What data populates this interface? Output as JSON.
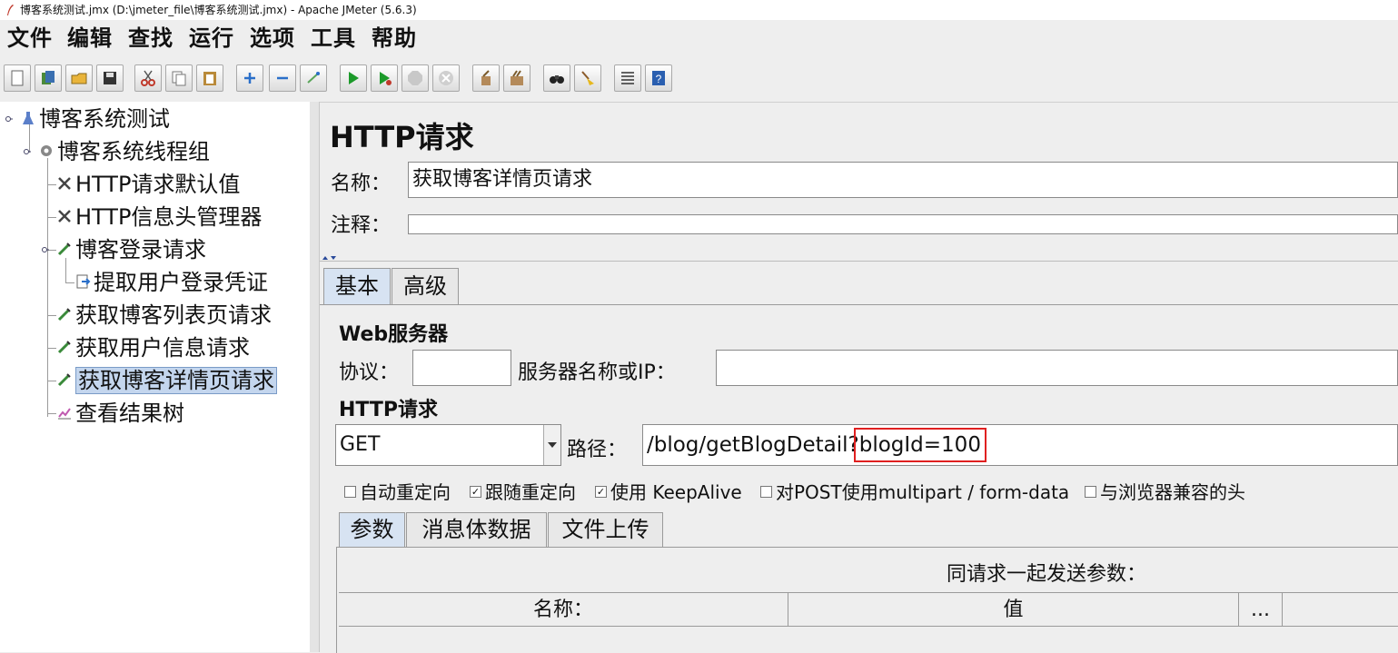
{
  "window": {
    "title": "博客系统测试.jmx (D:\\jmeter_file\\博客系统测试.jmx) - Apache JMeter (5.6.3)"
  },
  "menu": [
    "文件",
    "编辑",
    "查找",
    "运行",
    "选项",
    "工具",
    "帮助"
  ],
  "toolbar": [
    "new-icon",
    "templates-icon",
    "open-icon",
    "save-icon",
    "cut-icon",
    "copy-icon",
    "paste-icon",
    "expand-icon",
    "collapse-icon",
    "toggle-icon",
    "start-icon",
    "start-no-pause-icon",
    "stop-icon",
    "shutdown-icon",
    "clear-icon",
    "clear-all-icon",
    "search-icon",
    "reset-search-icon",
    "function-helper-icon",
    "help-icon"
  ],
  "tree": {
    "items": [
      {
        "label": "博客系统测试"
      },
      {
        "label": "博客系统线程组"
      },
      {
        "label": "HTTP请求默认值"
      },
      {
        "label": "HTTP信息头管理器"
      },
      {
        "label": "博客登录请求"
      },
      {
        "label": "提取用户登录凭证"
      },
      {
        "label": "获取博客列表页请求"
      },
      {
        "label": "获取用户信息请求"
      },
      {
        "label": "获取博客详情页请求",
        "selected": true
      },
      {
        "label": "查看结果树"
      }
    ]
  },
  "panel": {
    "heading": "HTTP请求",
    "name_label": "名称：",
    "name_value": "获取博客详情页请求",
    "comment_label": "注释：",
    "comment_value": "",
    "tabs": [
      "基本",
      "高级"
    ],
    "active_tab": "基本",
    "web_server": {
      "title": "Web服务器",
      "protocol_label": "协议：",
      "protocol_value": "",
      "server_label": "服务器名称或IP：",
      "server_value": ""
    },
    "http_request": {
      "title": "HTTP请求",
      "method": "GET",
      "path_label": "路径：",
      "path_prefix": "/blog/getBlogDetail?",
      "path_highlight": "blogId=100",
      "highlight_color": "#e02020"
    },
    "options": [
      {
        "label": "自动重定向",
        "checked": false
      },
      {
        "label": "跟随重定向",
        "checked": true
      },
      {
        "label": "使用 KeepAlive",
        "checked": true
      },
      {
        "label": "对POST使用multipart / form-data",
        "checked": false
      },
      {
        "label": "与浏览器兼容的头",
        "checked": false
      }
    ],
    "sub_tabs": [
      "参数",
      "消息体数据",
      "文件上传"
    ],
    "active_sub_tab": "参数",
    "params": {
      "caption": "同请求一起发送参数：",
      "columns": [
        "名称：",
        "值",
        "..."
      ]
    }
  }
}
